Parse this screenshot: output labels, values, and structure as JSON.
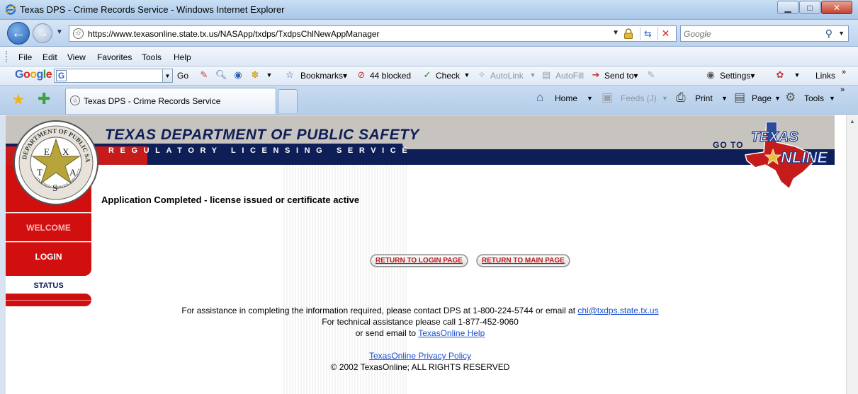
{
  "window": {
    "title": "Texas DPS - Crime Records Service - Windows Internet Explorer",
    "min": "▁",
    "max": "□",
    "close": "✕"
  },
  "address": {
    "url": "https://www.texasonline.state.tx.us/NASApp/txdps/TxdpsChlNewAppManager",
    "search_placeholder": "Google"
  },
  "menu": [
    "File",
    "Edit",
    "View",
    "Favorites",
    "Tools",
    "Help"
  ],
  "google_bar": {
    "go": "Go",
    "bookmarks": "Bookmarks▾",
    "blocked": "44 blocked",
    "check": "Check",
    "autolink": "AutoLink",
    "autofill": "AutoFill",
    "send_to": "Send to▾",
    "settings": "Settings▾",
    "links": "Links"
  },
  "tab": {
    "title": "Texas DPS - Crime Records Service"
  },
  "command_bar": {
    "home": "Home",
    "feeds": "Feeds (J)",
    "print": "Print",
    "page": "Page",
    "tools": "Tools"
  },
  "banner": {
    "title": "TEXAS DEPARTMENT OF PUBLIC SAFETY",
    "subtitle": "REGULATORY LICENSING SERVICE",
    "goto": "GO TO"
  },
  "sidebar": {
    "welcome": "WELCOME",
    "login": "LOGIN",
    "status": "STATUS"
  },
  "main": {
    "status_message": "Application Completed - license issued or certificate active",
    "return_login": "RETURN TO LOGIN PAGE",
    "return_main": "RETURN TO MAIN PAGE"
  },
  "footer": {
    "assist_text": "For assistance in completing the information required, please contact DPS at 1-800-224-5744 or email at",
    "assist_email": "chl@txdps.state.tx.us",
    "tech_text": "For technical assistance please call 1-877-452-9060",
    "send_text": "or send email to",
    "help_link": "TexasOnline Help",
    "privacy_link": "TexasOnline Privacy Policy",
    "copyright": "© 2002 TexasOnline; ALL RIGHTS RESERVED"
  },
  "colors": {
    "navy": "#0e1e57",
    "red": "#d10f0f",
    "link": "#1a4fd1"
  }
}
